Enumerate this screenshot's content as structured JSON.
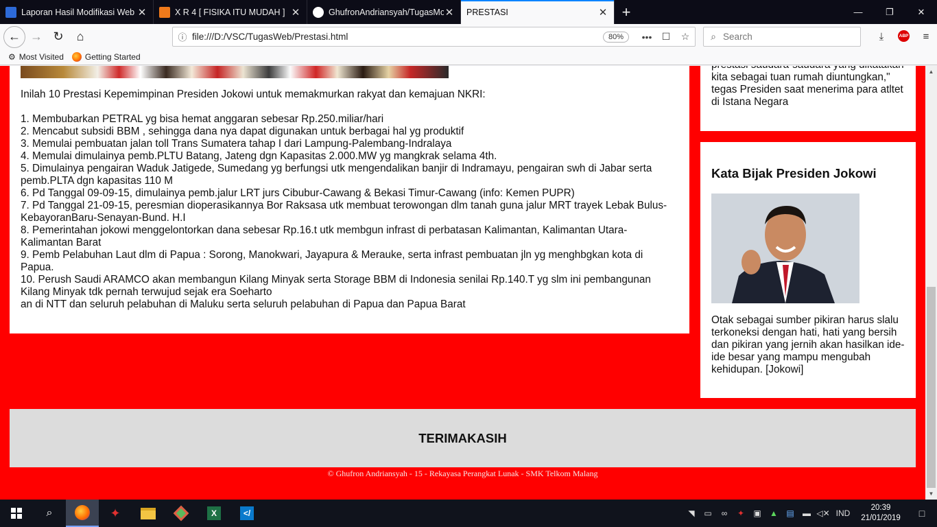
{
  "browser": {
    "tabs": [
      {
        "title": "Laporan Hasil Modifikasi Web",
        "icon": "bookmark-page-icon",
        "color": "#2d6ad8"
      },
      {
        "title": "X R 4 [ FISIKA ITU MUDAH ]",
        "icon": "blogger-icon",
        "color": "#f07a1b"
      },
      {
        "title": "GhufronAndriansyah/TugasMo",
        "icon": "github-icon",
        "color": "#ffffff"
      },
      {
        "title": "PRESTASI",
        "icon": "",
        "color": ""
      }
    ],
    "url": "file:///D:/VSC/TugasWeb/Prestasi.html",
    "zoom": "80%",
    "search_placeholder": "Search",
    "abp_label": "ABP",
    "bookmarks": [
      {
        "label": "Most Visited"
      },
      {
        "label": "Getting Started"
      }
    ]
  },
  "page": {
    "intro": "Inilah 10 Prestasi Kepemimpinan Presiden Jokowi untuk memakmurkan rakyat dan kemajuan NKRI:",
    "list": [
      "1. Membubarkan PETRAL yg bisa hemat anggaran sebesar Rp.250.miliar/hari",
      "2. Mencabut subsidi BBM , sehingga dana nya dapat digunakan untuk berbagai hal yg produktif",
      "3. Memulai pembuatan jalan toll Trans Sumatera tahap I dari Lampung-Palembang-Indralaya",
      "4. Memulai dimulainya pemb.PLTU Batang, Jateng dgn Kapasitas 2.000.MW yg mangkrak selama 4th.",
      "5. Dimulainya pengairan Waduk Jatigede, Sumedang yg berfungsi utk mengendalikan banjir di Indramayu, pengairan swh di Jabar serta pemb.PLTA dgn kapasitas 110 M",
      "6. Pd Tanggal 09-09-15, dimulainya pemb.jalur LRT jurs Cibubur-Cawang & Bekasi Timur-Cawang (info: Kemen PUPR)",
      "7. Pd Tanggal 21-09-15, peresmian dioperasikannya Bor Raksasa utk membuat terowongan dlm tanah guna jalur MRT trayek Lebak Bulus-KebayoranBaru-Senayan-Bund. H.I",
      "8. Pemerintahan jokowi menggelontorkan dana sebesar Rp.16.t utk membgun infrast di perbatasan Kalimantan, Kalimantan Utara-Kalimantan Barat",
      "9. Pemb Pelabuhan Laut dlm di Papua : Sorong, Manokwari, Jayapura & Merauke, serta infrast pembuatan jln yg menghbgkan kota di Papua.",
      "10. Perush Saudi ARAMCO akan membangun Kilang Minyak serta Storage BBM di Indonesia senilai Rp.140.T yg slm ini pembangunan Kilang Minyak tdk pernah terwujud sejak era Soeharto",
      "an di NTT dan seluruh pelabuhan di Maluku serta seluruh pelabuhan di Papua dan Papua Barat"
    ],
    "side_quote_tail": "prestasi saudara-saudara yang dikatakan kita sebagai tuan rumah diuntungkan,\" tegas Presiden saat menerima para atltet di Istana Negara",
    "kata_bijak_title": "Kata Bijak Presiden Jokowi",
    "kata_bijak_text": "Otak sebagai sumber pikiran harus slalu terkoneksi dengan hati, hati yang bersih dan pikiran yang jernih akan hasilkan ide-ide besar yang mampu mengubah kehidupan. [Jokowi]",
    "footer_title": "TERIMAKASIH",
    "copyright": "© Ghufron Andriansyah - 15 - Rekayasa Perangkat Lunak - SMK Telkom Malang",
    "background_color": "#ff0000"
  },
  "taskbar": {
    "lang": "IND",
    "time": "20:39",
    "date": "21/01/2019"
  }
}
